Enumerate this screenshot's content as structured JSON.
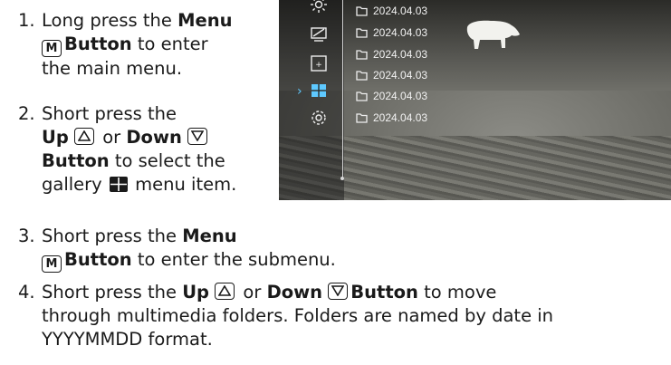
{
  "steps": [
    {
      "number": "1.",
      "line1_a": "Long press the ",
      "line1_b": "Menu",
      "key": "M",
      "line2_a": "Button",
      "line2_b": " to enter",
      "line3": "the main menu."
    },
    {
      "number": "2.",
      "line1": "Short press the",
      "line2_a": "Up",
      "line2_b": " or ",
      "line2_c": "Down",
      "line3_a": "Button",
      "line3_b": " to select the",
      "line4_a": "gallery ",
      "line4_b": " menu item."
    },
    {
      "number": "3.",
      "line1_a": "Short press the ",
      "line1_b": "Menu",
      "key": "M",
      "line2_a": "Button",
      "line2_b": " to enter the submenu."
    },
    {
      "number": "4.",
      "line1_a": "Short press the ",
      "line1_b": "Up",
      "line1_c": " or ",
      "line1_d": "Down",
      "line1_e": "Button",
      "line1_f": " to move",
      "line2": "through multimedia folders. Folders are named by date in",
      "line3": "YYYYMMDD format."
    }
  ],
  "device_screen": {
    "menu_icons": [
      "thermal-mode-icon",
      "display-icon",
      "zoom-icon",
      "gallery-icon",
      "settings-icon"
    ],
    "selected_icon": "gallery-icon",
    "accent_color": "#5ec9ff",
    "folders": [
      "2024.04.03",
      "2024.04.03",
      "2024.04.03",
      "2024.04.03",
      "2024.04.03",
      "2024.04.03"
    ]
  }
}
